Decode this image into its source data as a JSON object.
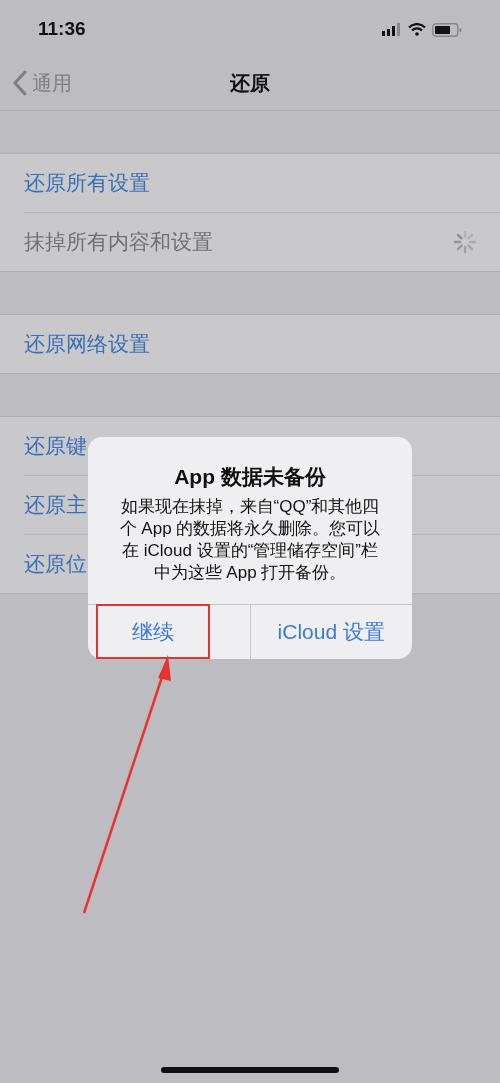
{
  "status_bar": {
    "time": "11:36"
  },
  "nav": {
    "back": "通用",
    "title": "还原"
  },
  "groups": [
    {
      "rows": [
        {
          "label": "还原所有设置",
          "disabled": false,
          "busy": false
        },
        {
          "label": "抹掉所有内容和设置",
          "disabled": true,
          "busy": true
        }
      ]
    },
    {
      "rows": [
        {
          "label": "还原网络设置",
          "disabled": false,
          "busy": false
        }
      ]
    },
    {
      "rows": [
        {
          "label": "还原键",
          "disabled": false,
          "busy": false
        },
        {
          "label": "还原主",
          "disabled": false,
          "busy": false
        },
        {
          "label": "还原位",
          "disabled": false,
          "busy": false
        }
      ]
    }
  ],
  "alert": {
    "title": "App 数据未备份",
    "message": "如果现在抹掉，来自“QQ”和其他四个 App 的数据将永久删除。您可以在 iCloud 设置的“管理储存空间”栏中为这些 App 打开备份。",
    "buttons": [
      {
        "label": "继续",
        "highlighted": true
      },
      {
        "label": "iCloud 设置",
        "highlighted": false
      }
    ]
  }
}
